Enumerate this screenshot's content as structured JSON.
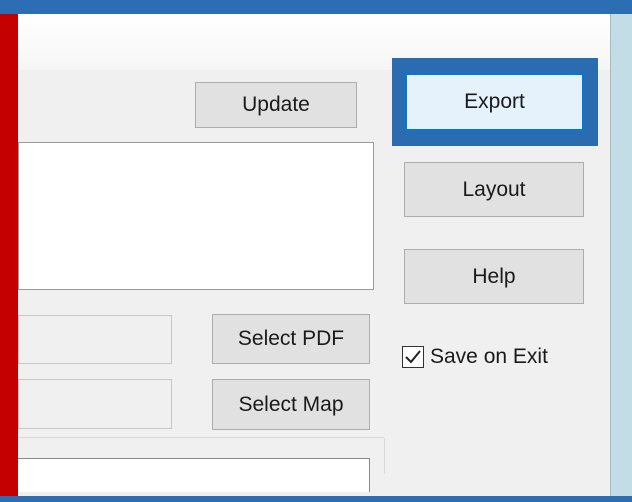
{
  "buttons": {
    "update": "Update",
    "export": "Export",
    "layout": "Layout",
    "help": "Help",
    "select_pdf": "Select PDF",
    "select_map": "Select Map"
  },
  "checkbox": {
    "label": "Save on Exit",
    "checked": true
  },
  "fields": {
    "notes_value": "",
    "pdf_path_value": "",
    "map_path_value": "",
    "bottom_value": ""
  },
  "colors": {
    "highlight": "#2b6cb0",
    "accent_border": "#0078d7",
    "frame_red": "#c40000"
  }
}
